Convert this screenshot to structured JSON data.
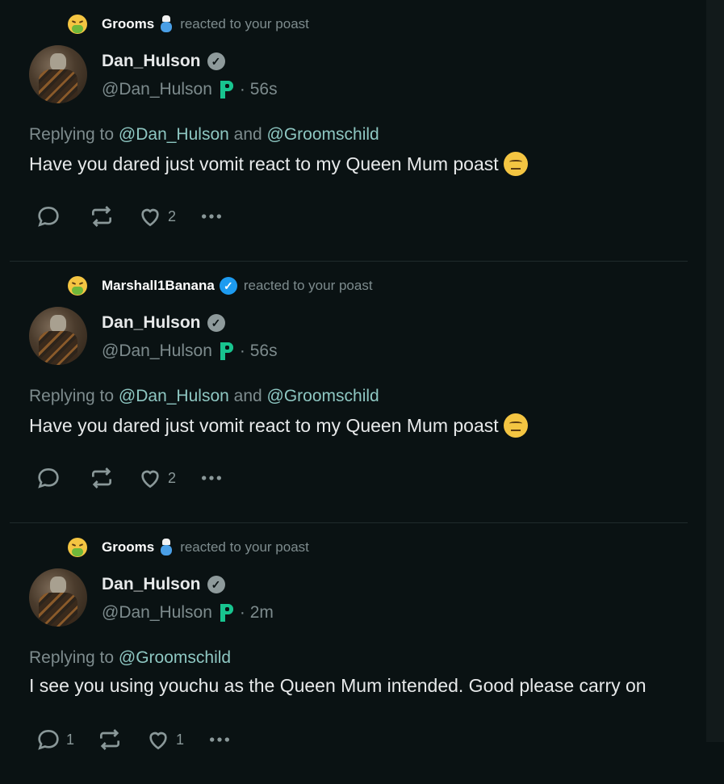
{
  "posts": [
    {
      "reactor": "Grooms",
      "reactor_badge": "chef-icon",
      "reaction_text": "reacted to your poast",
      "author_name": "Dan_Hulson",
      "handle": "@Dan_Hulson",
      "time": "· 56s",
      "replying_prefix": "Replying to",
      "mentions": [
        "@Dan_Hulson",
        "@Groomschild"
      ],
      "joiner": "and",
      "body": "Have you dared just vomit react to my Queen Mum poast",
      "has_think_emoji": true,
      "reply_count": "",
      "like_count": "2"
    },
    {
      "reactor": "Marshall1Banana",
      "reactor_badge": "verified-icon",
      "reaction_text": "reacted to your poast",
      "author_name": "Dan_Hulson",
      "handle": "@Dan_Hulson",
      "time": "· 56s",
      "replying_prefix": "Replying to",
      "mentions": [
        "@Dan_Hulson",
        "@Groomschild"
      ],
      "joiner": "and",
      "body": "Have you dared just vomit react to my Queen Mum poast",
      "has_think_emoji": true,
      "reply_count": "",
      "like_count": "2"
    },
    {
      "reactor": "Grooms",
      "reactor_badge": "chef-icon",
      "reaction_text": "reacted to your poast",
      "author_name": "Dan_Hulson",
      "handle": "@Dan_Hulson",
      "time": "· 2m",
      "replying_prefix": "Replying to",
      "mentions": [
        "@Groomschild"
      ],
      "joiner": "",
      "body": "I see you using youchu as the Queen Mum intended. Good please carry on",
      "has_think_emoji": false,
      "reply_count": "1",
      "like_count": "1"
    }
  ],
  "colors": {
    "background": "#0a1213",
    "muted": "#7d8b8d",
    "mention": "#8ec7c2",
    "verified": "#1d9bf0",
    "p_badge": "#18c48f"
  }
}
